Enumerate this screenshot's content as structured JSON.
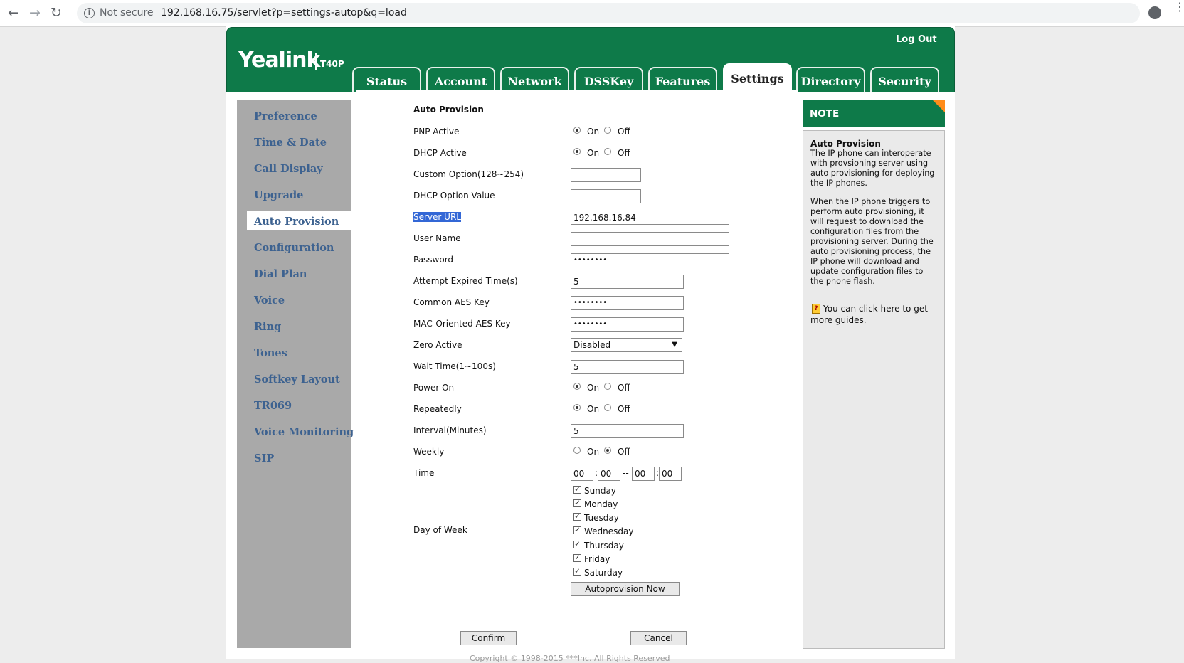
{
  "browser": {
    "security_label": "Not secure",
    "url": "192.168.16.75/servlet?p=settings-autop&q=load"
  },
  "header": {
    "logo": "Yealink",
    "model": "T40P",
    "logout": "Log Out",
    "tabs": [
      "Status",
      "Account",
      "Network",
      "DSSKey",
      "Features",
      "Settings",
      "Directory",
      "Security"
    ],
    "active_tab": "Settings"
  },
  "sidebar": {
    "items": [
      "Preference",
      "Time & Date",
      "Call Display",
      "Upgrade",
      "Auto Provision",
      "Configuration",
      "Dial Plan",
      "Voice",
      "Ring",
      "Tones",
      "Softkey Layout",
      "TR069",
      "Voice Monitoring",
      "SIP"
    ],
    "active": "Auto Provision"
  },
  "form": {
    "section_title": "Auto Provision",
    "radio_on": "On",
    "radio_off": "Off",
    "pnp_active": {
      "label": "PNP Active",
      "value": "On"
    },
    "dhcp_active": {
      "label": "DHCP Active",
      "value": "On"
    },
    "custom_option": {
      "label": "Custom Option(128~254)",
      "value": ""
    },
    "dhcp_option_value": {
      "label": "DHCP Option Value",
      "value": ""
    },
    "server_url": {
      "label": "Server URL",
      "value": "192.168.16.84"
    },
    "user_name": {
      "label": "User Name",
      "value": ""
    },
    "password": {
      "label": "Password",
      "value": "••••••••"
    },
    "attempt_expired": {
      "label": "Attempt Expired Time(s)",
      "value": "5"
    },
    "common_aes": {
      "label": "Common AES Key",
      "value": "••••••••"
    },
    "mac_aes": {
      "label": "MAC-Oriented AES Key",
      "value": "••••••••"
    },
    "zero_active": {
      "label": "Zero Active",
      "value": "Disabled"
    },
    "wait_time": {
      "label": "Wait Time(1~100s)",
      "value": "5"
    },
    "power_on": {
      "label": "Power On",
      "value": "On"
    },
    "repeatedly": {
      "label": "Repeatedly",
      "value": "On"
    },
    "interval": {
      "label": "Interval(Minutes)",
      "value": "5"
    },
    "weekly": {
      "label": "Weekly",
      "value": "Off"
    },
    "time": {
      "label": "Time",
      "start_h": "00",
      "start_m": "00",
      "end_h": "00",
      "end_m": "00",
      "colon": ":",
      "dash": "--"
    },
    "day_of_week": {
      "label": "Day of Week",
      "days": [
        "Sunday",
        "Monday",
        "Tuesday",
        "Wednesday",
        "Thursday",
        "Friday",
        "Saturday"
      ],
      "checked": [
        true,
        true,
        true,
        true,
        true,
        true,
        true
      ]
    },
    "autoprovision_now": "Autoprovision Now",
    "confirm": "Confirm",
    "cancel": "Cancel"
  },
  "note": {
    "heading": "NOTE",
    "title": "Auto Provision",
    "p1": "The IP phone can interoperate with provsioning server using auto provisioning for deploying the IP phones.",
    "p2": "When the IP phone triggers to perform auto provisioning, it will request to download the configuration files from the provisioning server. During the auto provisioning process, the IP phone will download and update configuration files to the phone flash.",
    "guide": "You can click here to get more guides."
  },
  "footer": {
    "copyright": "Copyright © 1998-2015 ***Inc. All Rights Reserved"
  },
  "colors": {
    "brand_green": "#0e7a49",
    "sidebar_gray": "#a9a9a9",
    "sidebar_link": "#3d6290",
    "note_corner": "#ff8c1a",
    "selection_highlight": "#3367d6"
  }
}
